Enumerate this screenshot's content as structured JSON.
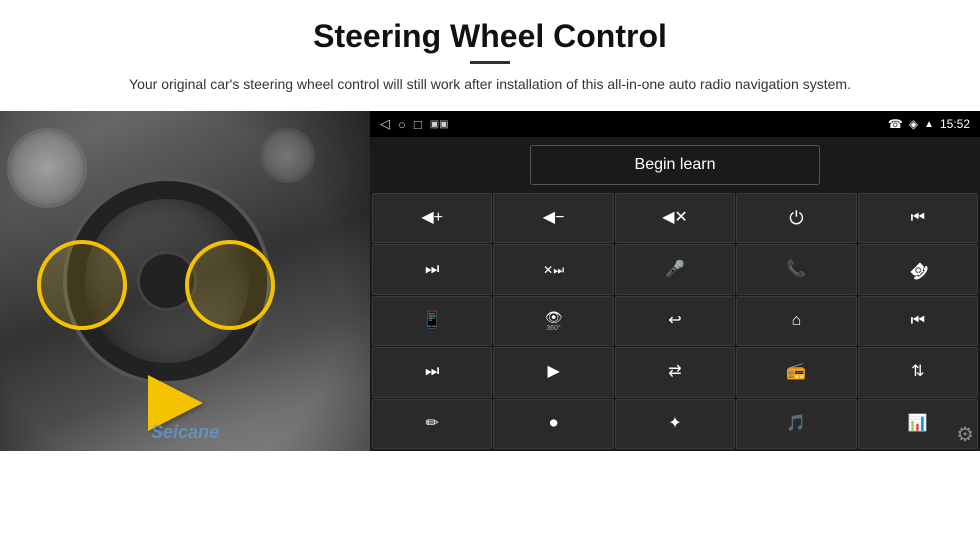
{
  "header": {
    "title": "Steering Wheel Control",
    "subtitle": "Your original car's steering wheel control will still work after installation of this all-in-one auto radio navigation system."
  },
  "status_bar": {
    "time": "15:52",
    "nav_icons": [
      "◁",
      "○",
      "□",
      "▣"
    ],
    "right_icons": [
      "☎",
      "◈",
      "▾",
      "15:52"
    ]
  },
  "begin_learn_btn": "Begin learn",
  "controls": [
    {
      "icon": "🔊+",
      "label": "vol up"
    },
    {
      "icon": "🔊-",
      "label": "vol dn"
    },
    {
      "icon": "🔊✕",
      "label": "mute"
    },
    {
      "icon": "⏻",
      "label": "power"
    },
    {
      "icon": "⏮",
      "label": "prev"
    },
    {
      "icon": "⏭",
      "label": "next"
    },
    {
      "icon": "⏭⏮",
      "label": "skip"
    },
    {
      "icon": "🎤",
      "label": "mic"
    },
    {
      "icon": "📞",
      "label": "call"
    },
    {
      "icon": "↩",
      "label": "hangup"
    },
    {
      "icon": "📱",
      "label": "menu"
    },
    {
      "icon": "👁",
      "label": "360"
    },
    {
      "icon": "↩",
      "label": "back"
    },
    {
      "icon": "⌂",
      "label": "home"
    },
    {
      "icon": "⏮⏮",
      "label": "rew"
    },
    {
      "icon": "⏭⏭",
      "label": "ffw"
    },
    {
      "icon": "▶",
      "label": "nav"
    },
    {
      "icon": "⇄",
      "label": "swap"
    },
    {
      "icon": "📻",
      "label": "radio"
    },
    {
      "icon": "⇅",
      "label": "eq"
    },
    {
      "icon": "✏",
      "label": "edit"
    },
    {
      "icon": "⏺",
      "label": "record"
    },
    {
      "icon": "✦",
      "label": "bt"
    },
    {
      "icon": "🎵",
      "label": "music"
    },
    {
      "icon": "📊",
      "label": "viz"
    }
  ],
  "watermark": "Seicane",
  "settings_icon": "⚙"
}
